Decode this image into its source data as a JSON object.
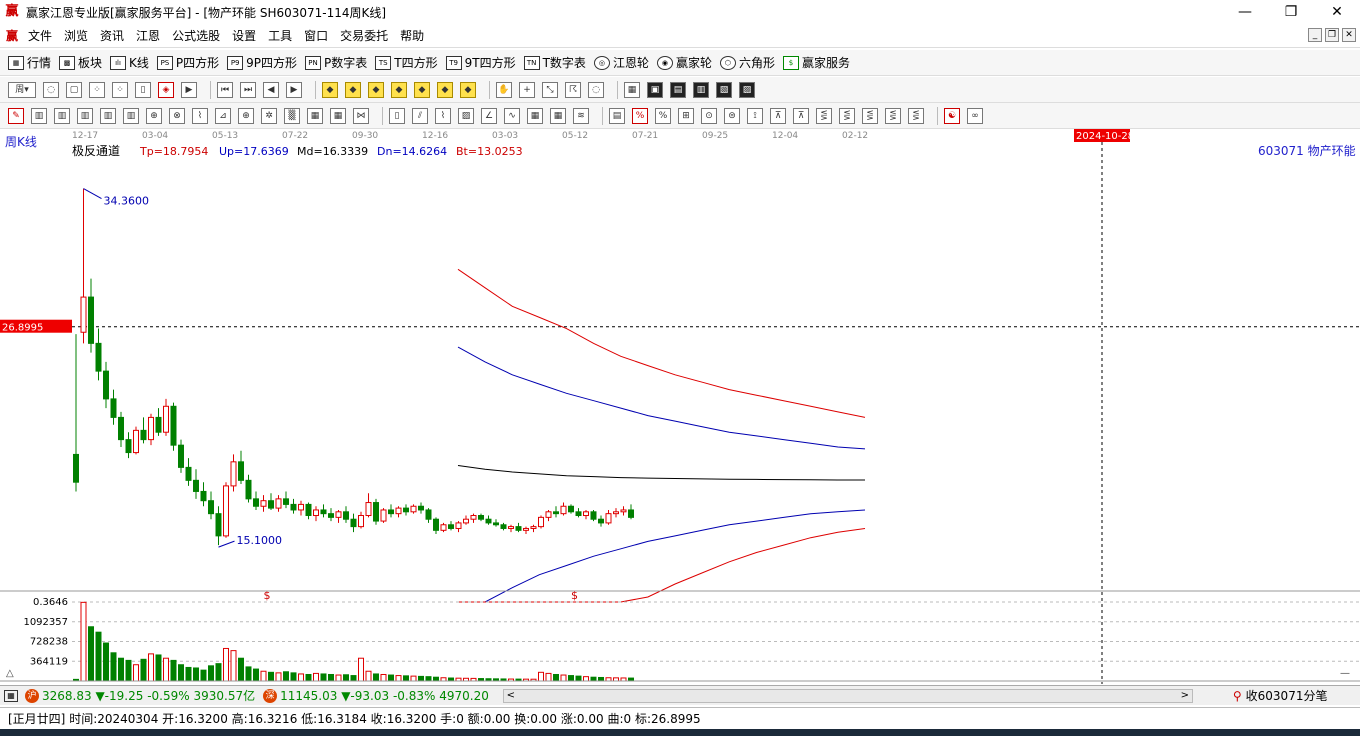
{
  "window": {
    "title": "[物产环能  SH603071-114周K线]",
    "app_title": "赢家江恩专业版[赢家服务平台] - ",
    "min_glyph": "—",
    "max_glyph": "❐",
    "close_glyph": "✕",
    "logo_glyph": "赢"
  },
  "menu": [
    "文件",
    "浏览",
    "资讯",
    "江恩",
    "公式选股",
    "设置",
    "工具",
    "窗口",
    "交易委托",
    "帮助"
  ],
  "toolbar1": [
    {
      "label": "行情",
      "icon": "grid-icon",
      "glyph": "▦"
    },
    {
      "label": "板块",
      "icon": "blocks-icon",
      "glyph": "▩"
    },
    {
      "label": "K线",
      "icon": "candle-icon",
      "glyph": "ılı"
    },
    {
      "label": "P四方形",
      "icon": "ps-icon",
      "glyph": "PS"
    },
    {
      "label": "9P四方形",
      "icon": "p9-icon",
      "glyph": "P9"
    },
    {
      "label": "P数字表",
      "icon": "pn-icon",
      "glyph": "PN"
    },
    {
      "label": "T四方形",
      "icon": "ts-icon",
      "glyph": "TS"
    },
    {
      "label": "9T四方形",
      "icon": "t9-icon",
      "glyph": "T9"
    },
    {
      "label": "T数字表",
      "icon": "tn-icon",
      "glyph": "TN"
    },
    {
      "label": "江恩轮",
      "icon": "gann-wheel-icon",
      "glyph": "◎"
    },
    {
      "label": "赢家轮",
      "icon": "winner-wheel-icon",
      "glyph": "◉"
    },
    {
      "label": "六角形",
      "icon": "hexagon-icon",
      "glyph": "⬡"
    },
    {
      "label": "赢家服务",
      "icon": "dollar-icon",
      "glyph": "$"
    }
  ],
  "period_selector": "周",
  "chart_data": {
    "type": "candlestick",
    "period_label": "周K线",
    "indicator_name": "极反通道",
    "indicator_values": {
      "Tp": "Tp=18.7954",
      "Up": "Up=17.6369",
      "Md": "Md=16.3339",
      "Dn": "Dn=14.6264",
      "Bt": "Bt=13.0253"
    },
    "stock_label": "603071  物产环能",
    "date_ticks": [
      "12-17",
      "03-04",
      "05-13",
      "07-22",
      "09-30",
      "12-16",
      "03-03",
      "05-12",
      "07-21",
      "09-25",
      "12-04",
      "02-12"
    ],
    "cursor_date": "2024-10-28",
    "cursor_price": "26.8995",
    "high_label": "34.3600",
    "low_label": "15.1000",
    "high_value": 34.36,
    "low_value": 15.1,
    "price_range": [
      13.0,
      36.5
    ],
    "channel": {
      "start_index": 55,
      "top": [
        30.0,
        29.0,
        28.0,
        27.4,
        26.8,
        26.0,
        25.3,
        24.8,
        24.3,
        23.9,
        23.5,
        23.2,
        22.9,
        22.6,
        22.3,
        22.0
      ],
      "upper": [
        25.8,
        25.0,
        24.3,
        23.8,
        23.3,
        22.9,
        22.5,
        22.1,
        21.8,
        21.5,
        21.2,
        21.0,
        20.8,
        20.6,
        20.4,
        20.3
      ],
      "middle": [
        19.4,
        19.2,
        19.05,
        18.95,
        18.85,
        18.8,
        18.75,
        18.72,
        18.7,
        18.68,
        18.66,
        18.65,
        18.64,
        18.63,
        18.62,
        18.62
      ],
      "lower": [
        10.5,
        11.8,
        12.8,
        13.5,
        14.0,
        14.5,
        14.9,
        15.3,
        15.6,
        15.9,
        16.2,
        16.4,
        16.6,
        16.8,
        16.9,
        17.0
      ],
      "bottom": [
        5.0,
        6.5,
        7.8,
        8.8,
        9.8,
        10.8,
        11.6,
        12.3,
        13.0,
        13.6,
        14.2,
        14.7,
        15.1,
        15.5,
        15.8,
        16.0
      ]
    },
    "candles": [
      [
        20.0,
        26.5,
        18.0,
        18.5
      ],
      [
        26.6,
        34.36,
        26.0,
        28.5
      ],
      [
        28.5,
        29.5,
        25.5,
        26.0
      ],
      [
        26.0,
        26.8,
        24.0,
        24.5
      ],
      [
        24.5,
        25.0,
        22.5,
        23.0
      ],
      [
        23.0,
        23.5,
        21.6,
        22.0
      ],
      [
        22.0,
        22.3,
        20.4,
        20.8
      ],
      [
        20.8,
        21.2,
        19.8,
        20.1
      ],
      [
        20.1,
        21.5,
        20.0,
        21.3
      ],
      [
        21.3,
        22.0,
        20.6,
        20.8
      ],
      [
        20.8,
        22.2,
        20.5,
        22.0
      ],
      [
        22.0,
        22.5,
        21.0,
        21.2
      ],
      [
        21.2,
        23.0,
        21.0,
        22.6
      ],
      [
        22.6,
        22.8,
        20.2,
        20.5
      ],
      [
        20.5,
        20.8,
        19.0,
        19.3
      ],
      [
        19.3,
        19.8,
        18.3,
        18.6
      ],
      [
        18.6,
        19.2,
        17.6,
        18.0
      ],
      [
        18.0,
        18.5,
        17.2,
        17.5
      ],
      [
        17.5,
        18.0,
        16.5,
        16.8
      ],
      [
        16.8,
        17.2,
        15.1,
        15.6
      ],
      [
        15.6,
        18.5,
        15.5,
        18.3
      ],
      [
        18.3,
        20.0,
        18.0,
        19.6
      ],
      [
        19.6,
        20.2,
        18.4,
        18.6
      ],
      [
        18.6,
        18.9,
        17.4,
        17.6
      ],
      [
        17.6,
        18.0,
        17.0,
        17.2
      ],
      [
        17.2,
        17.8,
        16.9,
        17.5
      ],
      [
        17.5,
        17.9,
        17.0,
        17.1
      ],
      [
        17.1,
        17.8,
        16.9,
        17.6
      ],
      [
        17.6,
        18.0,
        17.1,
        17.3
      ],
      [
        17.3,
        17.6,
        16.8,
        17.0
      ],
      [
        17.0,
        17.5,
        16.7,
        17.3
      ],
      [
        17.3,
        17.4,
        16.5,
        16.7
      ],
      [
        16.7,
        17.2,
        16.4,
        17.0
      ],
      [
        17.0,
        17.3,
        16.6,
        16.8
      ],
      [
        16.8,
        17.1,
        16.4,
        16.6
      ],
      [
        16.6,
        17.0,
        16.3,
        16.9
      ],
      [
        16.9,
        17.2,
        16.3,
        16.5
      ],
      [
        16.5,
        16.8,
        15.8,
        16.1
      ],
      [
        16.1,
        16.9,
        16.0,
        16.7
      ],
      [
        16.7,
        17.9,
        16.6,
        17.4
      ],
      [
        17.4,
        17.6,
        16.2,
        16.4
      ],
      [
        16.4,
        17.1,
        16.3,
        17.0
      ],
      [
        17.0,
        17.3,
        16.6,
        16.8
      ],
      [
        16.8,
        17.2,
        16.6,
        17.1
      ],
      [
        17.1,
        17.3,
        16.7,
        16.9
      ],
      [
        16.9,
        17.3,
        16.8,
        17.2
      ],
      [
        17.2,
        17.4,
        16.8,
        17.0
      ],
      [
        17.0,
        17.1,
        16.3,
        16.5
      ],
      [
        16.5,
        16.6,
        15.7,
        15.9
      ],
      [
        15.9,
        16.3,
        15.8,
        16.2
      ],
      [
        16.2,
        16.4,
        15.9,
        16.0
      ],
      [
        16.0,
        16.4,
        15.8,
        16.3
      ],
      [
        16.3,
        16.7,
        16.2,
        16.5
      ],
      [
        16.5,
        16.8,
        16.3,
        16.7
      ],
      [
        16.7,
        16.8,
        16.4,
        16.5
      ],
      [
        16.5,
        16.7,
        16.2,
        16.3
      ],
      [
        16.3,
        16.5,
        16.1,
        16.2
      ],
      [
        16.2,
        16.3,
        15.9,
        16.0
      ],
      [
        16.0,
        16.2,
        15.8,
        16.1
      ],
      [
        16.1,
        16.3,
        15.8,
        15.9
      ],
      [
        15.9,
        16.1,
        15.7,
        16.0
      ],
      [
        16.0,
        16.2,
        15.8,
        16.1
      ],
      [
        16.1,
        16.7,
        16.0,
        16.6
      ],
      [
        16.6,
        17.0,
        16.4,
        16.9
      ],
      [
        16.9,
        17.2,
        16.6,
        16.8
      ],
      [
        16.8,
        17.4,
        16.7,
        17.2
      ],
      [
        17.2,
        17.3,
        16.8,
        16.9
      ],
      [
        16.9,
        17.1,
        16.6,
        16.7
      ],
      [
        16.7,
        17.0,
        16.5,
        16.9
      ],
      [
        16.9,
        17.0,
        16.4,
        16.5
      ],
      [
        16.5,
        16.7,
        16.1,
        16.3
      ],
      [
        16.3,
        17.0,
        16.2,
        16.8
      ],
      [
        16.8,
        17.1,
        16.6,
        16.9
      ],
      [
        16.9,
        17.2,
        16.7,
        17.0
      ],
      [
        17.0,
        17.3,
        16.5,
        16.6
      ]
    ],
    "volume_labels": [
      "0.3646",
      "1092357",
      "728238",
      "364119"
    ],
    "volume_max": 1456476,
    "volumes": [
      30000,
      1450000,
      1000000,
      900000,
      700000,
      520000,
      420000,
      380000,
      300000,
      400000,
      500000,
      480000,
      420000,
      380000,
      300000,
      250000,
      240000,
      200000,
      280000,
      320000,
      600000,
      560000,
      420000,
      260000,
      220000,
      180000,
      160000,
      150000,
      170000,
      150000,
      130000,
      120000,
      140000,
      130000,
      120000,
      110000,
      115000,
      100000,
      420000,
      180000,
      130000,
      120000,
      110000,
      100000,
      95000,
      90000,
      85000,
      80000,
      70000,
      60000,
      55000,
      52000,
      50000,
      48000,
      45000,
      42000,
      40000,
      38000,
      36000,
      35000,
      34000,
      33000,
      160000,
      140000,
      120000,
      110000,
      100000,
      90000,
      80000,
      70000,
      65000,
      60000,
      58000,
      56000,
      54000
    ],
    "dollar_marks": [
      {
        "index": 25,
        "label": "$"
      },
      {
        "index": 66,
        "label": "$"
      }
    ]
  },
  "status": {
    "sh_value": "3268.83",
    "sh_change": "▼-19.25",
    "sh_pct": "-0.59%",
    "sh_amount": "3930.57亿",
    "sz_value": "11145.03",
    "sz_change": "▼-93.03",
    "sz_pct": "-0.83%",
    "sz_amount": "4970.20",
    "sh_icon": "沪",
    "sz_icon": "深",
    "tick_label": "收603071分笔"
  },
  "info": {
    "lunar": "[正月廿四]",
    "time": "时间:20240304",
    "open": "开:16.3200",
    "high": "高:16.3216",
    "low": "低:16.3184",
    "close": "收:16.3200",
    "hand": "手:0",
    "amount": "额:0.00",
    "turnover": "换:0.00",
    "change": "涨:0.00",
    "curve": "曲:0",
    "mark": "标:26.8995"
  }
}
